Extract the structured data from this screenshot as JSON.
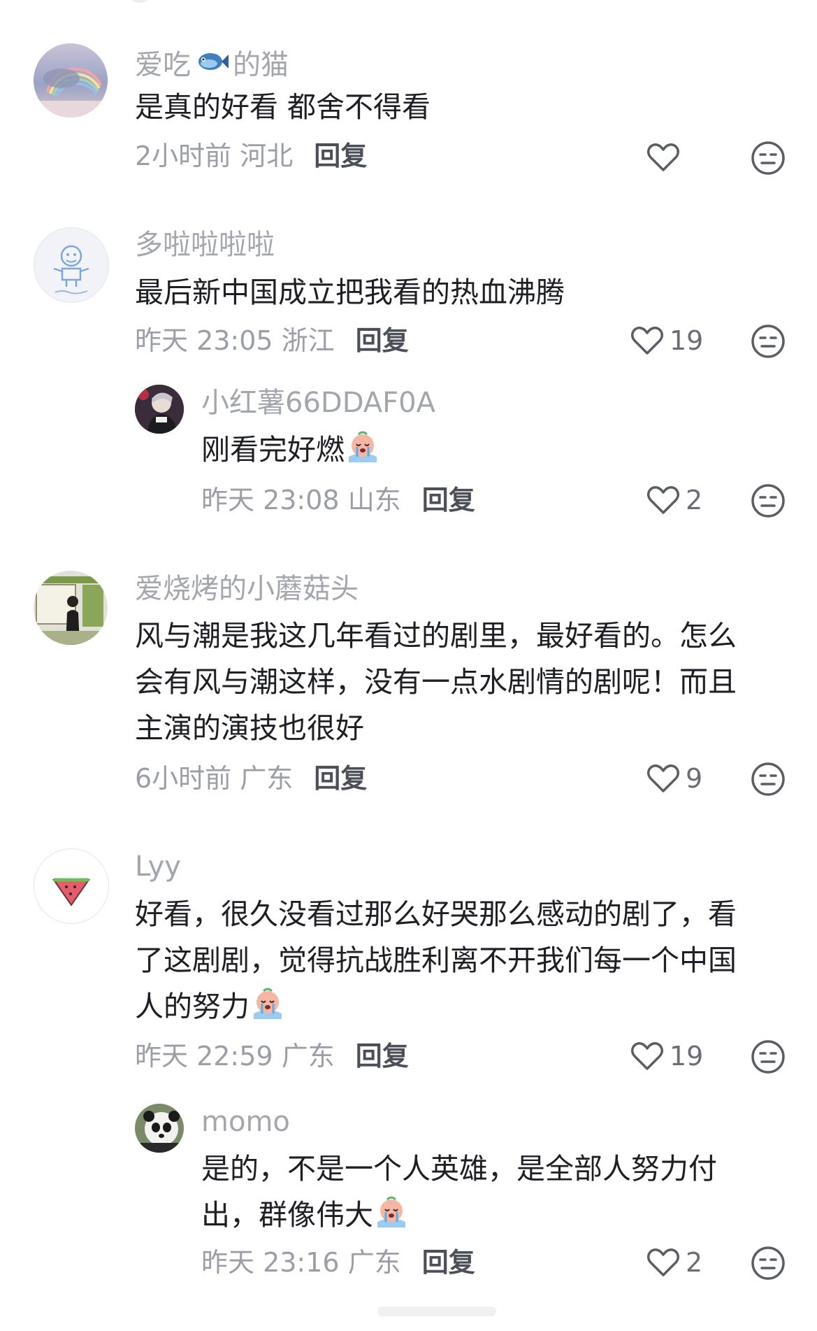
{
  "comments": [
    {
      "user": "爱吃",
      "user_suffix": "的猫",
      "text": [
        "是真的好看 都舍不得看"
      ],
      "time": "2小时前",
      "location": "河北",
      "reply_label": "回复",
      "likes": ""
    },
    {
      "user": "多啦啦啦啦",
      "text": [
        "最后新中国成立把我看的热血沸腾"
      ],
      "time": "昨天 23:05",
      "location": "浙江",
      "reply_label": "回复",
      "likes": "19"
    },
    {
      "user": "爱烧烤的小蘑菇头",
      "text": [
        "风与潮是我这几年看过的剧里，最好看的。怎么",
        "会有风与潮这样，没有一点水剧情的剧呢！而且",
        "主演的演技也很好"
      ],
      "time": "6小时前",
      "location": "广东",
      "reply_label": "回复",
      "likes": "9"
    },
    {
      "user": "Lyy",
      "text": [
        "好看，很久没看过那么好哭那么感动的剧了，看",
        "了这剧剧，觉得抗战胜利离不开我们每一个中国",
        "人的努力"
      ],
      "time": "昨天 22:59",
      "location": "广东",
      "reply_label": "回复",
      "likes": "19"
    }
  ],
  "replies": [
    {
      "user": "小红薯66DDAF0A",
      "text": [
        "刚看完好燃"
      ],
      "time": "昨天 23:08",
      "location": "山东",
      "reply_label": "回复",
      "likes": "2"
    },
    {
      "user": "momo",
      "text": [
        "是的，不是一个人英雄，是全部人努力付",
        "出，群像伟大"
      ],
      "time": "昨天 23:16",
      "location": "广东",
      "reply_label": "回复",
      "likes": "2"
    }
  ],
  "icons": {
    "like": "heart-outline-icon",
    "dislike": "meh-face-icon",
    "emoji": "crying-emoji",
    "fish": "fish-emoji"
  },
  "colors": {
    "username": "#a4a6ad",
    "text": "#1d1f24",
    "meta": "#9b9ea6",
    "reply": "#4c4f57",
    "icon": "#5a5d64"
  }
}
